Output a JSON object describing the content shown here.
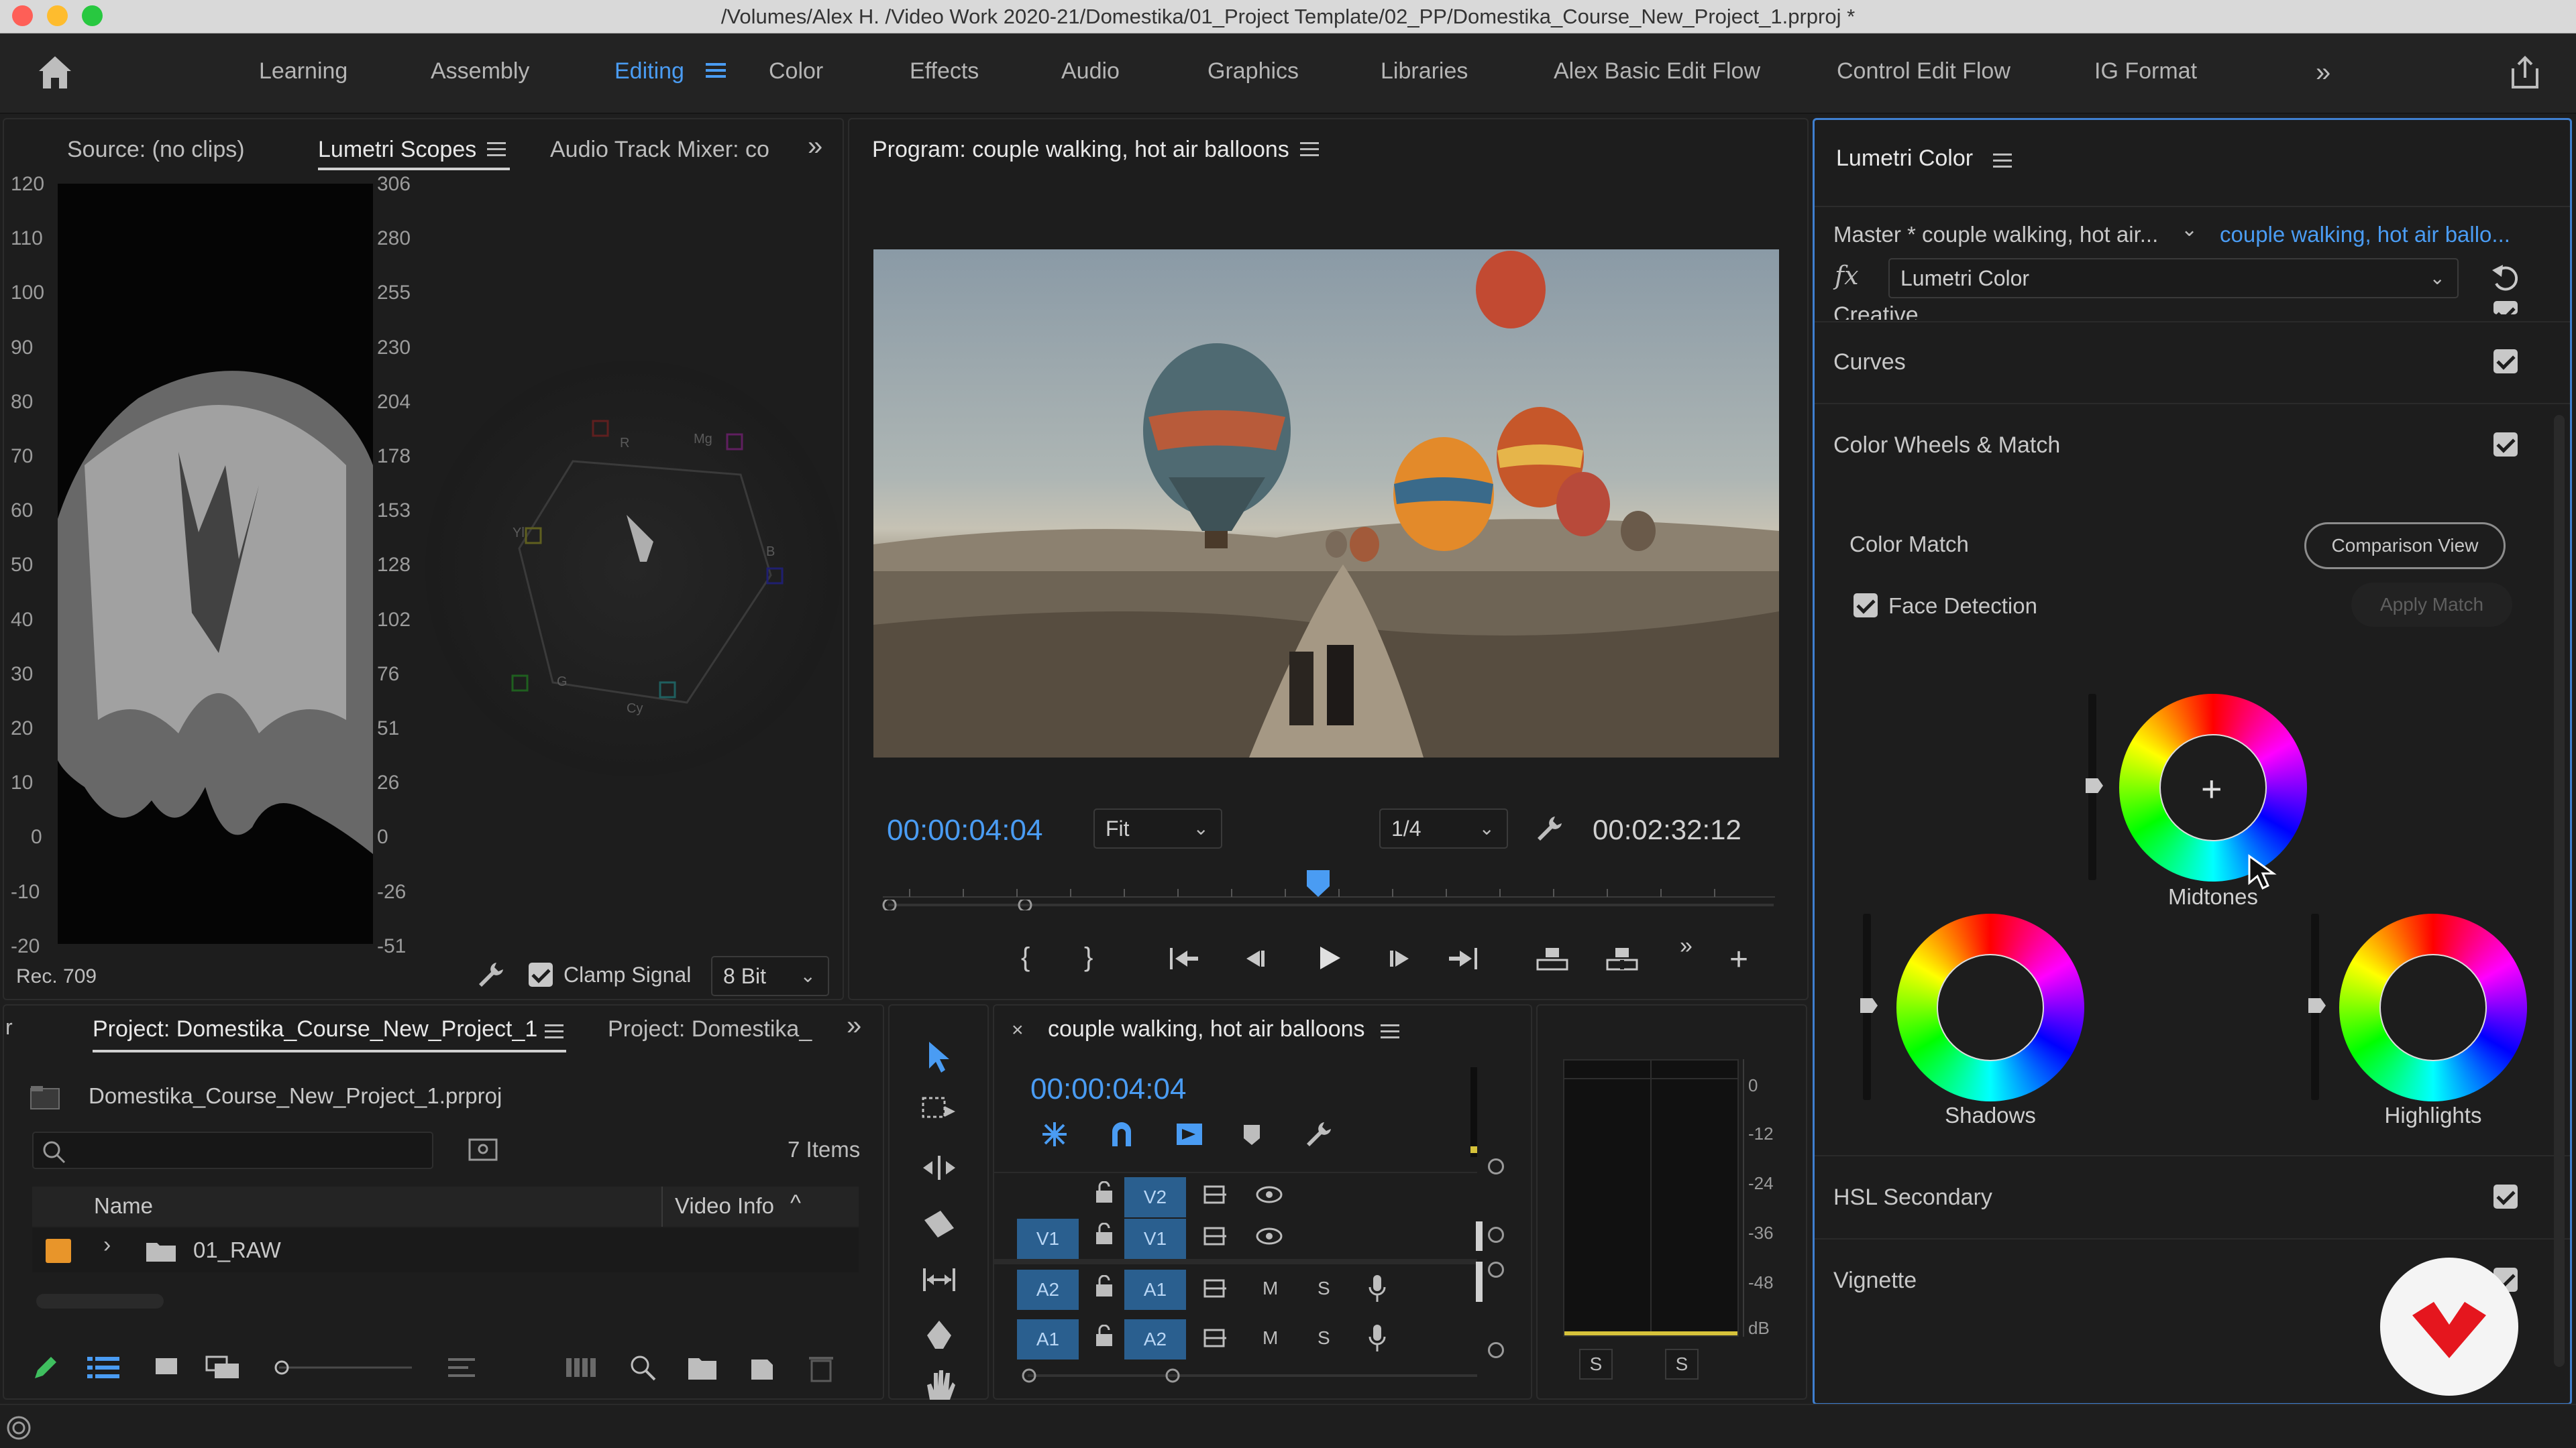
{
  "window": {
    "title": "/Volumes/Alex H. /Video Work 2020-21/Domestika/01_Project Template/02_PP/Domestika_Course_New_Project_1.prproj *"
  },
  "workspaces": {
    "items": [
      "Learning",
      "Assembly",
      "Editing",
      "Color",
      "Effects",
      "Audio",
      "Graphics",
      "Libraries",
      "Alex Basic Edit Flow",
      "Control Edit Flow",
      "IG Format"
    ],
    "active": "Editing"
  },
  "scopes_panel": {
    "tabs": [
      "Source: (no clips)",
      "Lumetri Scopes",
      "Audio Track Mixer: co"
    ],
    "active_tab": "Lumetri Scopes",
    "left_scale": [
      "120",
      "110",
      "100",
      "90",
      "80",
      "70",
      "60",
      "50",
      "40",
      "30",
      "20",
      "10",
      "0",
      "-10",
      "-20"
    ],
    "right_scale": [
      "306",
      "280",
      "255",
      "230",
      "204",
      "178",
      "153",
      "128",
      "102",
      "76",
      "51",
      "26",
      "0",
      "-26",
      "-51"
    ],
    "vector_labels": [
      "R",
      "Mg",
      "B",
      "Cy",
      "G",
      "Yl"
    ],
    "colorspace": "Rec. 709",
    "clamp_signal_label": "Clamp Signal",
    "bit_depth": "8 Bit"
  },
  "program_monitor": {
    "title": "Program: couple walking, hot air balloons",
    "current_timecode": "00:00:04:04",
    "zoom": "Fit",
    "resolution": "1/4",
    "duration": "00:02:32:12"
  },
  "project_panel": {
    "tabs": [
      "Project: Domestika_Course_New_Project_1",
      "Project: Domestika_"
    ],
    "file_name": "Domestika_Course_New_Project_1.prproj",
    "item_count": "7 Items",
    "columns": [
      "Name",
      "Video Info"
    ],
    "rows": [
      {
        "name": "01_RAW",
        "label_color": "#e8952a"
      }
    ]
  },
  "timeline": {
    "sequence_name": "couple walking, hot air balloons",
    "timecode": "00:00:04:04",
    "tracks": [
      {
        "source": "",
        "target": "V2",
        "type": "video"
      },
      {
        "source": "V1",
        "target": "V1",
        "type": "video"
      },
      {
        "source": "A2",
        "target": "A1",
        "type": "audio"
      },
      {
        "source": "A1",
        "target": "A2",
        "type": "audio"
      }
    ],
    "mute_label": "M",
    "solo_label": "S",
    "meter_scale": [
      "0",
      "-12",
      "-24",
      "-36",
      "-48",
      "dB"
    ],
    "meter_solo": [
      "S",
      "S"
    ]
  },
  "lumetri_color": {
    "panel_title": "Lumetri Color",
    "master_label": "Master * couple walking, hot air...",
    "clip_link": "couple walking, hot air ballo...",
    "effect_name": "Lumetri Color",
    "sections": [
      "Creative",
      "Curves",
      "Color Wheels & Match",
      "HSL Secondary",
      "Vignette"
    ],
    "color_match_label": "Color Match",
    "comparison_view_label": "Comparison View",
    "face_detection_label": "Face Detection",
    "apply_match_label": "Apply Match",
    "wheels": [
      "Midtones",
      "Shadows",
      "Highlights"
    ]
  },
  "colors": {
    "accent": "#4a9cf3",
    "panel_bg": "#1d1d1d",
    "brand": "#e5161e"
  }
}
